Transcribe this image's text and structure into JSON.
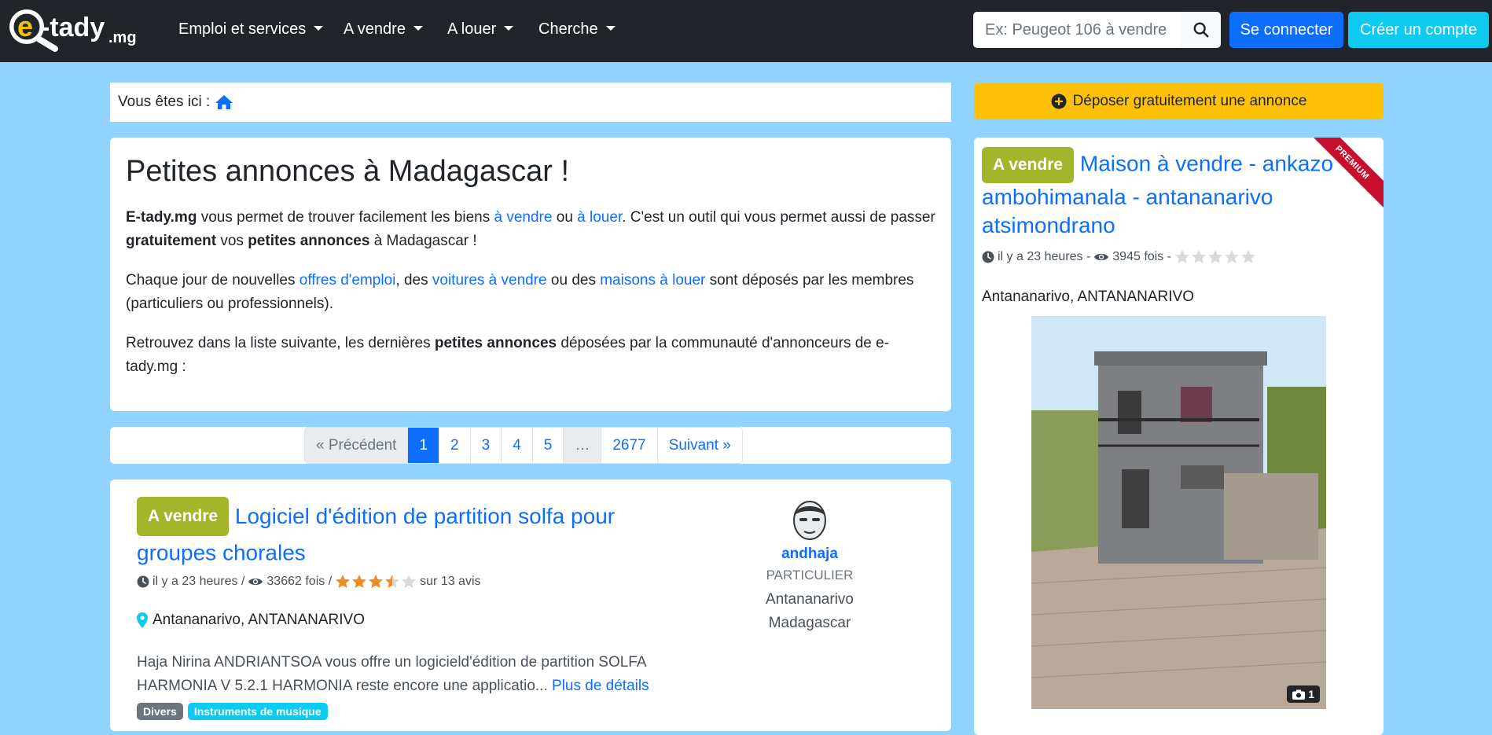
{
  "nav": {
    "logo_text": "e-tady",
    "logo_suffix": ".mg",
    "menu": [
      {
        "label": "Emploi et services"
      },
      {
        "label": "A vendre"
      },
      {
        "label": "A louer"
      },
      {
        "label": "Cherche"
      }
    ],
    "search_placeholder": "Ex: Peugeot 106 à vendre",
    "login_label": "Se connecter",
    "register_label": "Créer un compte"
  },
  "breadcrumb": {
    "prefix": "Vous êtes ici :"
  },
  "intro": {
    "title": "Petites annonces à Madagascar !",
    "p1": {
      "brand": "E-tady.mg",
      "t1": " vous permet de trouver facilement les biens ",
      "link1": "à vendre",
      "t2": " ou ",
      "link2": "à louer",
      "t3": ". C'est un outil qui vous permet aussi de passer ",
      "b1": "gratuitement",
      "t4": " vos ",
      "b2": "petites annonces",
      "t5": " à Madagascar !"
    },
    "p2": {
      "t1": "Chaque jour de nouvelles ",
      "link1": "offres d'emploi",
      "t2": ", des ",
      "link2": "voitures à vendre",
      "t3": " ou des ",
      "link3": "maisons à louer",
      "t4": " sont déposés par les membres (particuliers ou professionnels)."
    },
    "p3": {
      "t1": "Retrouvez dans la liste suivante, les dernières ",
      "b1": "petites annonces",
      "t2": " déposées par la communauté d'annonceurs de e-tady.mg :"
    }
  },
  "pagination": {
    "prev": "« Précédent",
    "pages": [
      "1",
      "2",
      "3",
      "4",
      "5",
      "…",
      "2677"
    ],
    "active": "1",
    "next": "Suivant »"
  },
  "listing": {
    "badge": "A vendre",
    "title": "Logiciel d'édition de partition solfa pour groupes chorales",
    "time": "il y a 23 heures /",
    "views": "33662 fois /",
    "rating": 3.5,
    "reviews": "sur 13 avis",
    "location": "Antananarivo, ANTANANARIVO",
    "description": "Haja Nirina ANDRIANTSOA  vous offre un logicield'édition de partition SOLFA HARMONIA V 5.2.1 HARMONIA reste encore une applicatio...",
    "more_link": "Plus de détails",
    "tags": [
      "Divers",
      "Instruments de musique"
    ],
    "seller": {
      "name": "andhaja",
      "type": "PARTICULIER",
      "city": "Antananarivo",
      "country": "Madagascar"
    }
  },
  "sidebar": {
    "post_button": "Déposer gratuitement une annonce",
    "premium": {
      "badge": "A vendre",
      "ribbon": "PREMIUM",
      "title": "Maison à vendre - ankazo ambohimanala - antananarivo atsimondrano",
      "time": "il y a 23 heures -",
      "views": "3945 fois -",
      "rating": 0,
      "location": "Antananarivo, ANTANANARIVO",
      "photo_count": "1"
    }
  },
  "colors": {
    "navbar": "#212529",
    "background": "#8fd3fe",
    "primary": "#0d6efd",
    "info": "#0dcaf0",
    "warning": "#ffc107",
    "badge_sale": "#a3b52b",
    "ribbon": "#c8102e"
  }
}
